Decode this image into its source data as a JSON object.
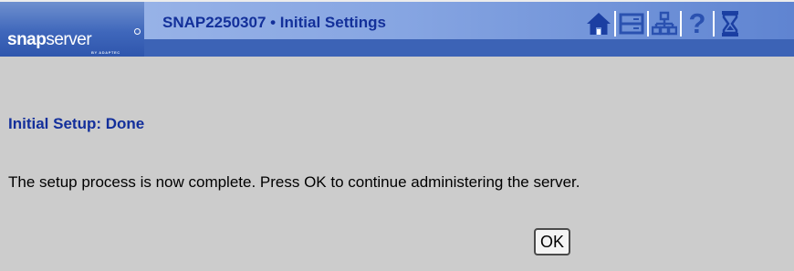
{
  "header": {
    "logo": {
      "brand_bold": "snap",
      "brand_regular": "server",
      "tagline": "BY ADAPTEC"
    },
    "title": "SNAP2250307 • Initial Settings",
    "icons": [
      {
        "name": "home-icon"
      },
      {
        "name": "server-icon"
      },
      {
        "name": "network-icon"
      },
      {
        "name": "help-icon",
        "glyph": "?"
      },
      {
        "name": "hourglass-icon"
      }
    ]
  },
  "main": {
    "heading": "Initial Setup: Done",
    "message": "The setup process is now complete. Press OK to continue administering the server.",
    "ok_label": "OK"
  },
  "colors": {
    "page_background": "#cccccc",
    "title_text": "#13309a",
    "heading_text": "#132f9b",
    "icon_blue": "#2a51b0",
    "logo_gradient_top": "#6f90cf",
    "logo_gradient_bottom": "#2f56ad",
    "title_bar_light": "#97b2e7",
    "title_bar_dark": "#5f84d1",
    "under_bar": "#3c63b6"
  }
}
